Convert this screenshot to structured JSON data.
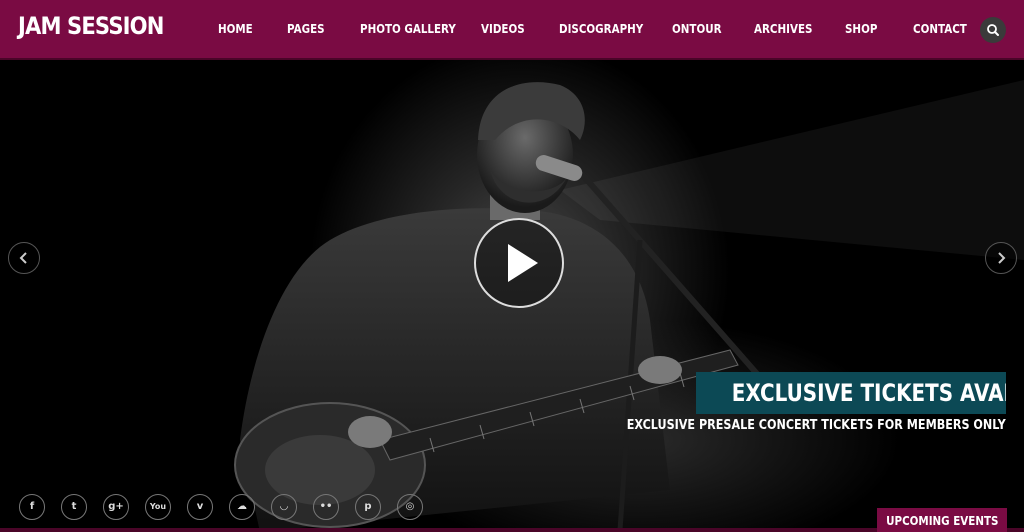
{
  "site": {
    "logo": "JAM SESSION"
  },
  "nav": {
    "items": [
      {
        "label": "HOME"
      },
      {
        "label": "PAGES"
      },
      {
        "label": "PHOTO GALLERY"
      },
      {
        "label": "VIDEOS"
      },
      {
        "label": "DISCOGRAPHY"
      },
      {
        "label": "ONTOUR"
      },
      {
        "label": "ARCHIVES"
      },
      {
        "label": "SHOP"
      },
      {
        "label": "CONTACT"
      }
    ],
    "search_icon": "search-icon"
  },
  "hero": {
    "image": "musician-with-guitar-photo",
    "title": "EXCLUSIVE TICKETS AVAILABLE",
    "subtitle": "EXCLUSIVE PRESALE CONCERT TICKETS FOR MEMBERS ONLY"
  },
  "social": [
    {
      "name": "facebook-icon",
      "glyph": "f"
    },
    {
      "name": "twitter-icon",
      "glyph": "t"
    },
    {
      "name": "google-plus-icon",
      "glyph": "g+"
    },
    {
      "name": "youtube-icon",
      "glyph": "You"
    },
    {
      "name": "vimeo-icon",
      "glyph": "v"
    },
    {
      "name": "soundcloud-icon",
      "glyph": "☁"
    },
    {
      "name": "lastfm-icon",
      "glyph": "◡"
    },
    {
      "name": "flickr-icon",
      "glyph": "••"
    },
    {
      "name": "pinterest-icon",
      "glyph": "p"
    },
    {
      "name": "instagram-icon",
      "glyph": "◎"
    }
  ],
  "upcoming_events": "UPCOMING EVENTS",
  "colors": {
    "header": "#7a0b43",
    "ticket_bg": "#0c4955",
    "upcoming_bg": "#7a0b43"
  }
}
